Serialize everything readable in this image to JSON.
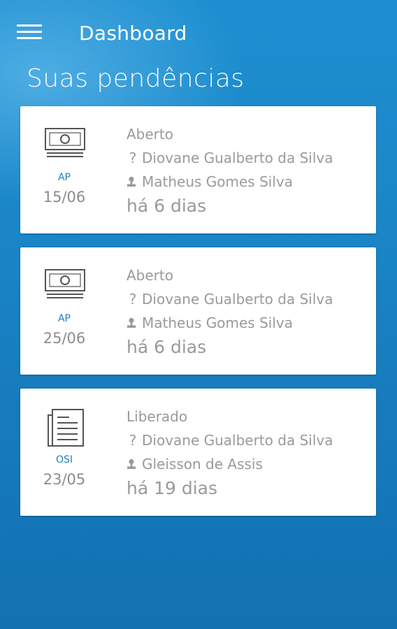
{
  "header": {
    "title": "Dashboard",
    "menu_icon": "hamburger-menu-icon"
  },
  "section": {
    "title": "Suas pendências"
  },
  "colors": {
    "background": "#1a86c8",
    "card": "#ffffff",
    "type_label": "#1f7fc0",
    "text_muted": "#9a9a9a"
  },
  "cards": [
    {
      "icon": "money-bill-icon",
      "type": "AP",
      "date": "15/06",
      "status": "Aberto",
      "requester_icon": "question-icon",
      "requester": "Diovane Gualberto da Silva",
      "assignee_icon": "person-icon",
      "assignee": "Matheus Gomes Silva",
      "age": "há 6 dias"
    },
    {
      "icon": "money-bill-icon",
      "type": "AP",
      "date": "25/06",
      "status": "Aberto",
      "requester_icon": "question-icon",
      "requester": "Diovane Gualberto da Silva",
      "assignee_icon": "person-icon",
      "assignee": "Matheus Gomes Silva",
      "age": "há 6 dias"
    },
    {
      "icon": "document-icon",
      "type": "OSI",
      "date": "23/05",
      "status": "Liberado",
      "requester_icon": "question-icon",
      "requester": "Diovane Gualberto da Silva",
      "assignee_icon": "person-icon",
      "assignee": "Gleisson de Assis",
      "age": "há 19 dias"
    }
  ]
}
